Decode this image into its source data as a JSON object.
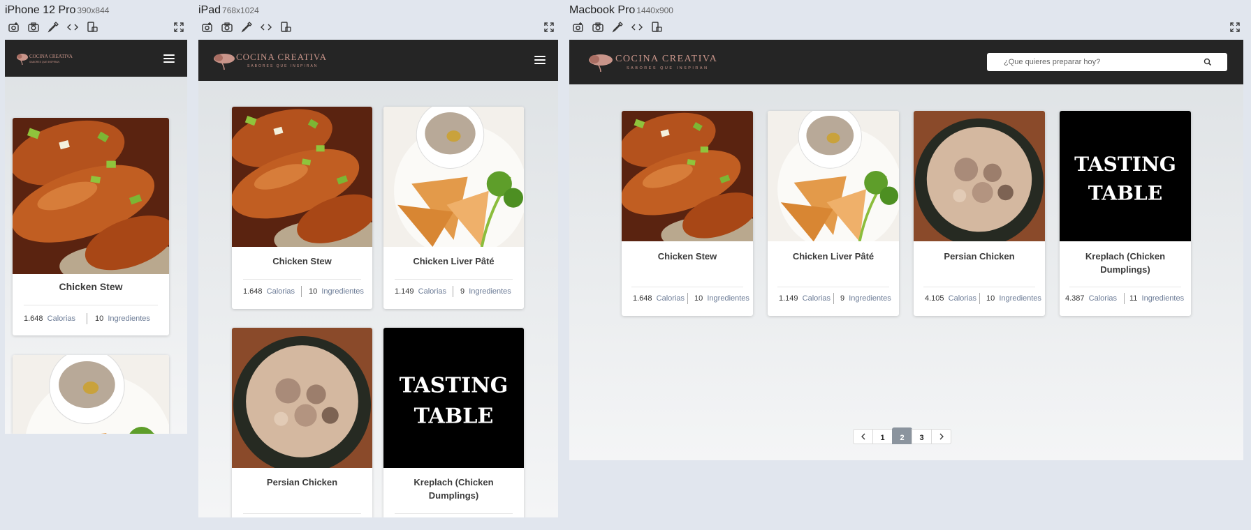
{
  "devices": [
    {
      "name": "iPhone 12 Pro",
      "dims": "390x844"
    },
    {
      "name": "iPad",
      "dims": "768x1024"
    },
    {
      "name": "Macbook Pro",
      "dims": "1440x900"
    }
  ],
  "toolbar_icons": [
    "screenshot-alt-icon",
    "camera-icon",
    "eyedropper-icon",
    "code-icon",
    "rotate-device-icon",
    "fullscreen-icon"
  ],
  "site": {
    "logo_text": "COCINA CREATIVA",
    "logo_tagline": "SABORES QUE INSPIRAN",
    "search_placeholder": "¿Que quieres preparar hoy?"
  },
  "recipes": [
    {
      "title": "Chicken Stew",
      "calories": "1.648",
      "calories_label": "Calorias",
      "ingredients": "10",
      "ingredients_label": "Ingredientes",
      "image": "chicken-stew-photo"
    },
    {
      "title": "Chicken Liver Pâté",
      "calories": "1.149",
      "calories_label": "Calorias",
      "ingredients": "9",
      "ingredients_label": "Ingredientes",
      "image": "liver-pate-photo"
    },
    {
      "title": "Persian Chicken",
      "calories": "4.105",
      "calories_label": "Calorias",
      "ingredients": "10",
      "ingredients_label": "Ingredientes",
      "image": "persian-chicken-photo"
    },
    {
      "title": "Kreplach (Chicken Dumplings)",
      "calories": "4.387",
      "calories_label": "Calorias",
      "ingredients": "11",
      "ingredients_label": "Ingredientes",
      "image": "tasting-table-logo"
    }
  ],
  "tasting_table_logo": "TASTING TABLE",
  "pagination": {
    "pages": [
      "1",
      "2",
      "3"
    ],
    "active": "2"
  }
}
